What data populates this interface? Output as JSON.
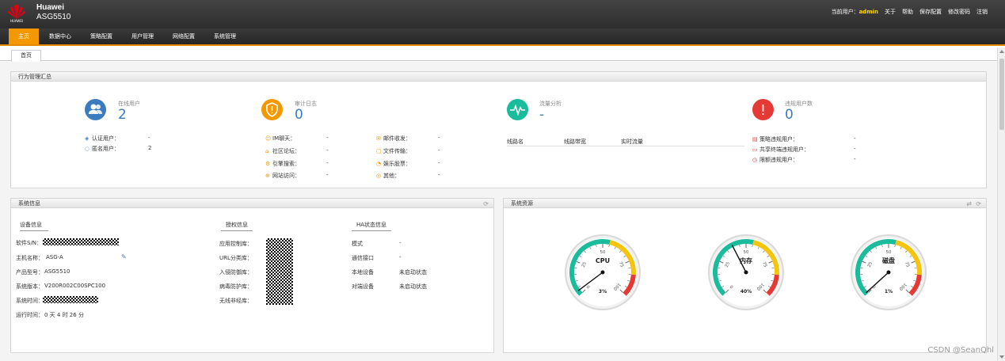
{
  "header": {
    "logo_text": "HUAWEI",
    "brand_name": "Huawei",
    "model": "ASG5510",
    "current_user_label": "当前用户：",
    "current_user": "admin",
    "links": [
      "关于",
      "帮助",
      "保存配置",
      "修改密码",
      "注销"
    ]
  },
  "nav": {
    "items": [
      "主页",
      "数据中心",
      "策略配置",
      "用户管理",
      "网络配置",
      "系统管理"
    ],
    "active": "主页"
  },
  "tabs": [
    "首页"
  ],
  "summary": {
    "title": "行为管理汇总",
    "online_users": {
      "title": "在线用户",
      "value": "2",
      "rows": [
        {
          "label": "认证用户：",
          "value": "-"
        },
        {
          "label": "匿名用户：",
          "value": "2"
        }
      ]
    },
    "audit_log": {
      "title": "审计日志",
      "value": "0",
      "left_rows": [
        {
          "label": "IM聊天：",
          "value": "-"
        },
        {
          "label": "社区论坛：",
          "value": "-"
        },
        {
          "label": "引擎搜索：",
          "value": "-"
        },
        {
          "label": "网站访问：",
          "value": "-"
        }
      ],
      "right_rows": [
        {
          "label": "邮件收发：",
          "value": "-"
        },
        {
          "label": "文件传输：",
          "value": "-"
        },
        {
          "label": "娱乐股票：",
          "value": "-"
        },
        {
          "label": "其他：",
          "value": "-"
        }
      ]
    },
    "traffic": {
      "title": "流量分析",
      "value": "-",
      "columns": [
        "线路名",
        "线路带宽",
        "实时流量"
      ]
    },
    "violation": {
      "title": "违规用户数",
      "value": "0",
      "rows": [
        {
          "label": "策略违规用户：",
          "value": "-"
        },
        {
          "label": "共享终端违规用户：",
          "value": "-"
        },
        {
          "label": "限额违规用户：",
          "value": "-"
        }
      ]
    }
  },
  "sysinfo": {
    "title": "系统信息",
    "device": {
      "title": "设备信息",
      "rows": [
        {
          "label": "软件S/N：",
          "value": ""
        },
        {
          "label": "主机名称：",
          "value": "ASG-A"
        },
        {
          "label": "产品型号：",
          "value": "ASG5510"
        },
        {
          "label": "系统版本：",
          "value": "V200R002C00SPC100"
        },
        {
          "label": "系统时间：",
          "value": ""
        },
        {
          "label": "运行时间：",
          "value": "0 天 4 时 26 分"
        }
      ]
    },
    "license": {
      "title": "授权信息",
      "rows": [
        "应用控制库：",
        "URL分类库：",
        "入侵防御库：",
        "病毒防护库：",
        "无线非经库："
      ]
    },
    "ha": {
      "title": "HA状态信息",
      "rows": [
        {
          "label": "模式",
          "value": "-"
        },
        {
          "label": "通信接口",
          "value": "-"
        },
        {
          "label": "本地设备",
          "value": "未启动状态"
        },
        {
          "label": "对端设备",
          "value": "未启动状态"
        }
      ]
    }
  },
  "sysres": {
    "title": "系统资源",
    "gauges": [
      {
        "label": "CPU",
        "percent": 3,
        "readout": "3%"
      },
      {
        "label": "内存",
        "percent": 40,
        "readout": "40%"
      },
      {
        "label": "磁盘",
        "percent": 1,
        "readout": "1%"
      }
    ],
    "tick_labels": [
      "0",
      "25",
      "50",
      "75",
      "100"
    ]
  },
  "colors": {
    "accent": "#f39800",
    "blue": "#3b7bbf",
    "orange": "#f39800",
    "teal": "#1abc9c",
    "red": "#e53935"
  },
  "watermark": "CSDN @SeanQhl"
}
